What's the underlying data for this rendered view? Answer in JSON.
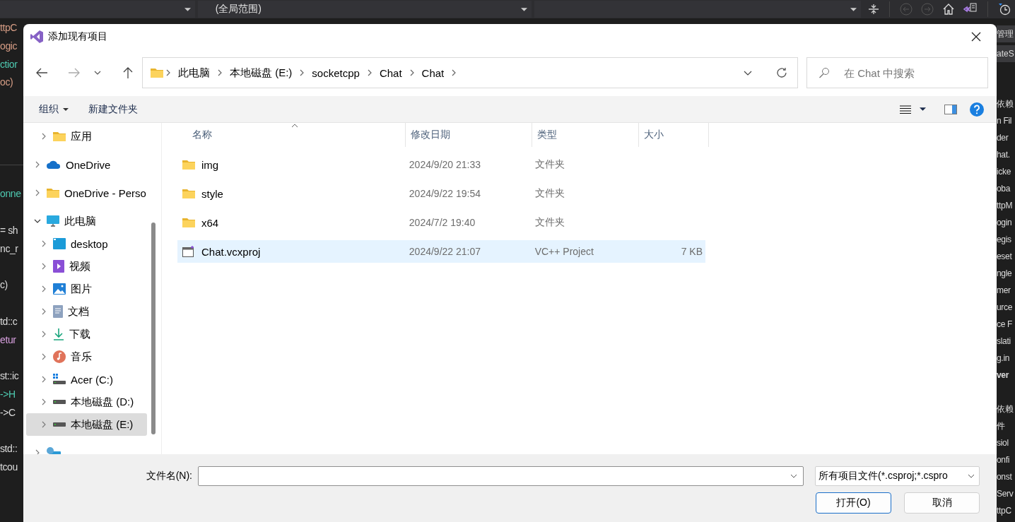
{
  "ide": {
    "scope_dropdown": "(全局范围)",
    "code_blocks": [
      [
        {
          "text": "ttpC",
          "color": "#d69d85"
        },
        {
          "text": "ogic",
          "color": "#d69d85"
        },
        {
          "text": "ctior",
          "color": "#4ec9b0"
        },
        {
          "text": "oc)",
          "color": "#d69d85"
        }
      ],
      [
        {
          "text": "onne",
          "color": "#4ec9b0"
        }
      ],
      [
        {
          "text": "= sh",
          "color": "#dcdcdc"
        },
        {
          "text": "nc_r",
          "color": "#dcdcdc"
        }
      ],
      [
        {
          "text": "c)",
          "color": "#dcdcdc"
        }
      ],
      [
        {
          "text": "td::c",
          "color": "#dcdcdc"
        },
        {
          "text": "etur",
          "color": "#d8a0df"
        }
      ],
      [
        {
          "text": "st::ic",
          "color": "#dcdcdc"
        },
        {
          "text": "->H",
          "color": "#4ec9b0"
        },
        {
          "text": "->C",
          "color": "#dcdcdc"
        }
      ],
      [
        {
          "text": "std::",
          "color": "#dcdcdc"
        },
        {
          "text": "tcou",
          "color": "#dcdcdc"
        }
      ]
    ],
    "solution_header": [
      "管理",
      "ateS"
    ],
    "solution_blocks": [
      [
        {
          "text": "依赖",
          "bold": false
        },
        {
          "text": "n Fil",
          "bold": false
        },
        {
          "text": "der",
          "bold": false
        },
        {
          "text": "hat.",
          "bold": false
        },
        {
          "text": "icke",
          "bold": false
        },
        {
          "text": "oba",
          "bold": false
        },
        {
          "text": "ttpM",
          "bold": false
        },
        {
          "text": "ogin",
          "bold": false
        },
        {
          "text": "egis",
          "bold": false
        },
        {
          "text": "eset",
          "bold": false
        },
        {
          "text": "ngle",
          "bold": false
        },
        {
          "text": "mer",
          "bold": false
        },
        {
          "text": "urce",
          "bold": false
        },
        {
          "text": "ce F",
          "bold": false
        },
        {
          "text": "slati",
          "bold": false
        },
        {
          "text": "g.in",
          "bold": false
        },
        {
          "text": "ver",
          "bold": true
        }
      ],
      [
        {
          "text": "依赖",
          "bold": false
        },
        {
          "text": "件",
          "bold": false
        },
        {
          "text": "siol",
          "bold": false
        },
        {
          "text": "onfi",
          "bold": false
        },
        {
          "text": "onst",
          "bold": false
        },
        {
          "text": "Serv",
          "bold": false
        },
        {
          "text": "ttpC",
          "bold": false
        }
      ]
    ]
  },
  "dialog": {
    "title": "添加现有项目",
    "breadcrumbs": [
      "此电脑",
      "本地磁盘 (E:)",
      "socketcpp",
      "Chat",
      "Chat"
    ],
    "search": {
      "placeholder": "在 Chat 中搜索"
    },
    "toolbar": {
      "organize": "组织",
      "new_folder": "新建文件夹"
    },
    "nav": {
      "partial_items": [
        {
          "label": "应用",
          "kind": "folder",
          "expanded": false,
          "selected": false
        }
      ],
      "items": [
        {
          "label": "OneDrive",
          "kind": "cloud",
          "expanded": false,
          "selected": false
        },
        {
          "label": "OneDrive - Perso",
          "kind": "folder",
          "expanded": false,
          "selected": false
        },
        {
          "label": "此电脑",
          "kind": "pc",
          "expanded": true,
          "selected": false,
          "children": [
            {
              "label": "desktop",
              "kind": "desktop",
              "expanded": false,
              "selected": false
            },
            {
              "label": "视频",
              "kind": "video",
              "expanded": false,
              "selected": false
            },
            {
              "label": "图片",
              "kind": "pictures",
              "expanded": false,
              "selected": false
            },
            {
              "label": "文档",
              "kind": "documents",
              "expanded": false,
              "selected": false
            },
            {
              "label": "下载",
              "kind": "downloads",
              "expanded": false,
              "selected": false
            },
            {
              "label": "音乐",
              "kind": "music",
              "expanded": false,
              "selected": false
            },
            {
              "label": "Acer (C:)",
              "kind": "system-drive",
              "expanded": false,
              "selected": false
            },
            {
              "label": "本地磁盘 (D:)",
              "kind": "drive",
              "expanded": false,
              "selected": false
            },
            {
              "label": "本地磁盘 (E:)",
              "kind": "drive",
              "expanded": false,
              "selected": true
            }
          ]
        },
        {
          "kind": "network",
          "expanded": false,
          "selected": false
        }
      ]
    },
    "columns": [
      {
        "label": "名称",
        "sorted": true
      },
      {
        "label": "修改日期",
        "sorted": false
      },
      {
        "label": "类型",
        "sorted": false
      },
      {
        "label": "大小",
        "sorted": false
      }
    ],
    "files": [
      {
        "name": "img",
        "modified": "2024/9/20 21:33",
        "type": "文件夹",
        "kind": "folder",
        "selected": false
      },
      {
        "name": "style",
        "modified": "2024/9/22 19:54",
        "type": "文件夹",
        "kind": "folder",
        "selected": false
      },
      {
        "name": "x64",
        "modified": "2024/7/2 19:40",
        "type": "文件夹",
        "kind": "folder",
        "selected": false
      },
      {
        "name": "Chat.vcxproj",
        "modified": "2024/9/22 21:07",
        "type": "VC++ Project",
        "size": "7 KB",
        "kind": "project",
        "selected": true
      }
    ],
    "filename_label": "文件名(N):",
    "filter": "所有项目文件(*.csproj;*.cspro",
    "buttons": [
      {
        "label": "打开(O)",
        "default": true
      },
      {
        "label": "取消",
        "default": false
      }
    ]
  }
}
